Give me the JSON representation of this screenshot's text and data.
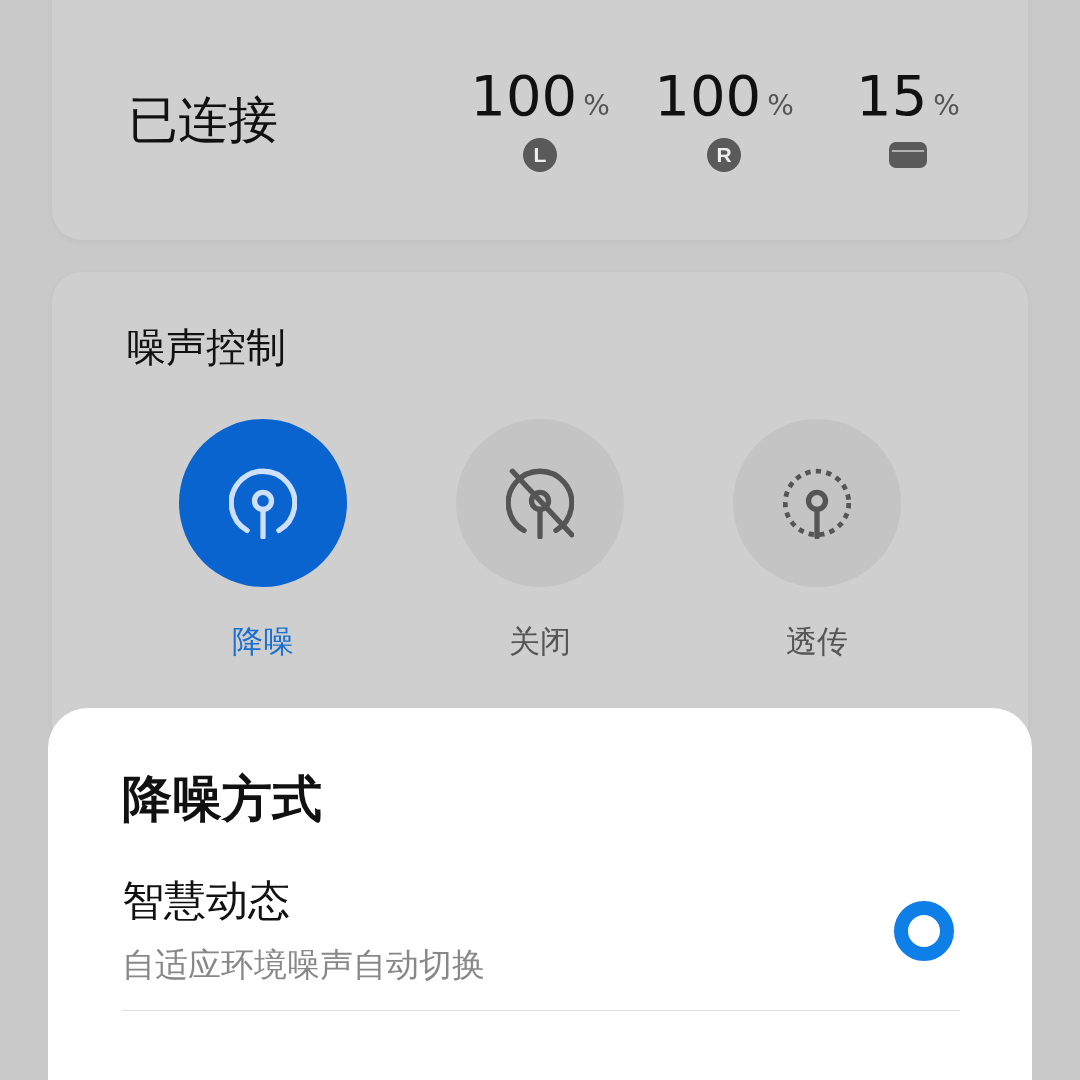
{
  "connection": {
    "status": "已连接",
    "batteries": [
      {
        "kind": "earbud",
        "value": "100",
        "unit": "%",
        "badge": "L"
      },
      {
        "kind": "earbud",
        "value": "100",
        "unit": "%",
        "badge": "R"
      },
      {
        "kind": "case",
        "value": "15",
        "unit": "%"
      }
    ]
  },
  "noise_control": {
    "title": "噪声控制",
    "modes": [
      {
        "kind": "anc",
        "label": "降噪",
        "selected": true
      },
      {
        "kind": "off",
        "label": "关闭",
        "selected": false
      },
      {
        "kind": "transparency",
        "label": "透传",
        "selected": false
      }
    ]
  },
  "sheet": {
    "title": "降噪方式",
    "options": [
      {
        "title": "智慧动态",
        "subtitle": "自适应环境噪声自动切换",
        "selected": true
      }
    ]
  }
}
